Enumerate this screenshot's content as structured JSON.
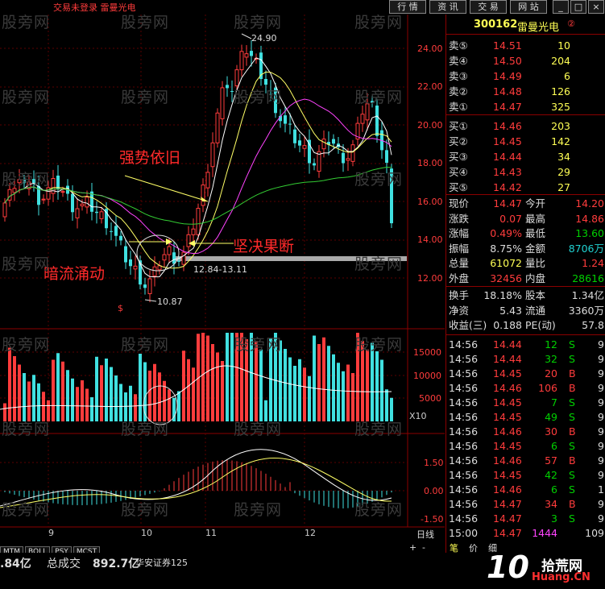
{
  "topbar": {
    "status": "交易未登录  雷曼光电",
    "buttons": [
      "行 情",
      "资 讯",
      "交 易",
      "网 站"
    ],
    "win_controls": [
      "_",
      "□",
      "×"
    ]
  },
  "chart": {
    "price_ticks": [
      "24.00",
      "22.00",
      "20.00",
      "18.00",
      "16.00",
      "14.00",
      "12.00"
    ],
    "vol_ticks": [
      "15000",
      "10000",
      "5000",
      "X10"
    ],
    "ind_ticks": [
      "1.50",
      "0.00",
      "-1.50"
    ],
    "x_labels": [
      "9",
      "10",
      "11",
      "12"
    ],
    "period": "日线",
    "nav": [
      "+",
      "-"
    ],
    "high_label": "24.90",
    "low_label": "10.87",
    "zone_label": "12.84-13.11",
    "annotations": {
      "strong": "强势依旧",
      "decisive": "坚决果断",
      "undercurrent": "暗流涌动"
    },
    "watermark": "股旁网",
    "indicator_tabs": [
      "MTM",
      "BOLL",
      "PSY",
      "MCST"
    ],
    "marker": "$"
  },
  "quote": {
    "code": "300162",
    "name": "雷曼光电",
    "sells": [
      {
        "label": "卖⑤",
        "price": "14.51",
        "vol": "10"
      },
      {
        "label": "卖④",
        "price": "14.50",
        "vol": "204"
      },
      {
        "label": "卖③",
        "price": "14.49",
        "vol": "6"
      },
      {
        "label": "卖②",
        "price": "14.48",
        "vol": "126"
      },
      {
        "label": "卖①",
        "price": "14.47",
        "vol": "325"
      }
    ],
    "buys": [
      {
        "label": "买①",
        "price": "14.46",
        "vol": "203"
      },
      {
        "label": "买②",
        "price": "14.45",
        "vol": "142"
      },
      {
        "label": "买③",
        "price": "14.44",
        "vol": "34"
      },
      {
        "label": "买④",
        "price": "14.43",
        "vol": "29"
      },
      {
        "label": "买⑤",
        "price": "14.42",
        "vol": "27"
      }
    ],
    "stats": [
      {
        "l1": "现价",
        "v1": "14.47",
        "l2": "今开",
        "v2": "14.20",
        "c1": "#ff3c3c",
        "c2": "#ff3c3c"
      },
      {
        "l1": "涨跌",
        "v1": "0.07",
        "l2": "最高",
        "v2": "14.86",
        "c1": "#ff3c3c",
        "c2": "#ff3c3c"
      },
      {
        "l1": "涨幅",
        "v1": "0.49%",
        "l2": "最低",
        "v2": "13.60",
        "c1": "#ff3c3c",
        "c2": "#00d000"
      },
      {
        "l1": "振幅",
        "v1": "8.75%",
        "l2": "金额",
        "v2": "8706万",
        "c1": "#dddddd",
        "c2": "#20d0d0"
      },
      {
        "l1": "总量",
        "v1": "61072",
        "l2": "量比",
        "v2": "1.24",
        "c1": "#ffff55",
        "c2": "#ff3c3c"
      },
      {
        "l1": "外盘",
        "v1": "32456",
        "l2": "内盘",
        "v2": "28616",
        "c1": "#ff3c3c",
        "c2": "#00d000"
      }
    ],
    "fund": [
      {
        "l1": "换手",
        "v1": "18.18%",
        "l2": "股本",
        "v2": "1.34亿"
      },
      {
        "l1": "净资",
        "v1": "5.43",
        "l2": "流通",
        "v2": "3360万"
      },
      {
        "l1": "收益(三)",
        "v1": "0.188",
        "l2": "PE(动)",
        "v2": "57.8"
      }
    ],
    "ticks": [
      {
        "t": "14:56",
        "p": "14.44",
        "v": "12",
        "s": "S",
        "n": "9"
      },
      {
        "t": "14:56",
        "p": "14.44",
        "v": "32",
        "s": "S",
        "n": "9"
      },
      {
        "t": "14:56",
        "p": "14.45",
        "v": "20",
        "s": "B",
        "n": "9"
      },
      {
        "t": "14:56",
        "p": "14.46",
        "v": "106",
        "s": "B",
        "n": "9"
      },
      {
        "t": "14:56",
        "p": "14.45",
        "v": "7",
        "s": "S",
        "n": "9"
      },
      {
        "t": "14:56",
        "p": "14.45",
        "v": "49",
        "s": "S",
        "n": "9"
      },
      {
        "t": "14:56",
        "p": "14.46",
        "v": "30",
        "s": "B",
        "n": "9"
      },
      {
        "t": "14:56",
        "p": "14.45",
        "v": "6",
        "s": "S",
        "n": "9"
      },
      {
        "t": "14:56",
        "p": "14.46",
        "v": "57",
        "s": "B",
        "n": "9"
      },
      {
        "t": "14:56",
        "p": "14.45",
        "v": "42",
        "s": "S",
        "n": "9"
      },
      {
        "t": "14:56",
        "p": "14.46",
        "v": "6",
        "s": "S",
        "n": "1"
      },
      {
        "t": "14:56",
        "p": "14.47",
        "v": "34",
        "s": "B",
        "n": "9"
      },
      {
        "t": "14:56",
        "p": "14.47",
        "v": "3",
        "s": "S",
        "n": "9"
      },
      {
        "t": "15:00",
        "p": "14.47",
        "v": "1444",
        "s": "",
        "n": "109"
      }
    ],
    "bottom_tabs": [
      "笔",
      "价",
      "细"
    ]
  },
  "bottom": {
    "amount_partial": ".84亿",
    "total_label": "总成交",
    "total_value": "892.7亿",
    "broker": "华安证券125"
  },
  "logo": {
    "main": "10",
    "text1": "拾荒网",
    "text2": "Huang.CN"
  }
}
